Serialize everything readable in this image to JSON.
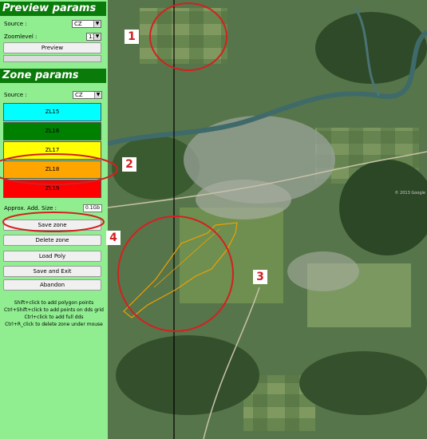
{
  "preview": {
    "title": "Preview params",
    "source_label": "Source :",
    "source_value": "CZ",
    "zoom_label": "Zoomlevel :",
    "zoom_value": "13",
    "preview_button": "Preview"
  },
  "zone": {
    "title": "Zone params",
    "source_label": "Source :",
    "source_value": "CZ",
    "zoom_buttons": [
      {
        "label": "ZL15",
        "color": "#00FFFF"
      },
      {
        "label": "ZL16",
        "color": "#008000"
      },
      {
        "label": "ZL17",
        "color": "#FFFF00"
      },
      {
        "label": "ZL18",
        "color": "#FFA500"
      },
      {
        "label": "ZL19",
        "color": "#FF0000"
      }
    ],
    "size_label": "Approx. Add. Size :",
    "size_value": "0.1Gb",
    "buttons": {
      "save": "Save zone",
      "delete": "Delete zone",
      "load": "Load Poly",
      "save_exit": "Save and Exit",
      "abandon": "Abandon"
    }
  },
  "help": [
    "Shift+click to add polygon points",
    "Ctrl+Shift+click to add points on dds grid",
    "Ctrl+click to add full dds",
    "Ctrl+R_click to delete zone under mouse"
  ],
  "annotations": [
    "1",
    "2",
    "3",
    "4"
  ],
  "map_watermark": "© 2013 Google",
  "colors": {
    "panel_bg": "#90EE90",
    "header_bg": "#0a7a0a",
    "annotation_red": "#d42020",
    "zone_outline": "#f0a000"
  }
}
